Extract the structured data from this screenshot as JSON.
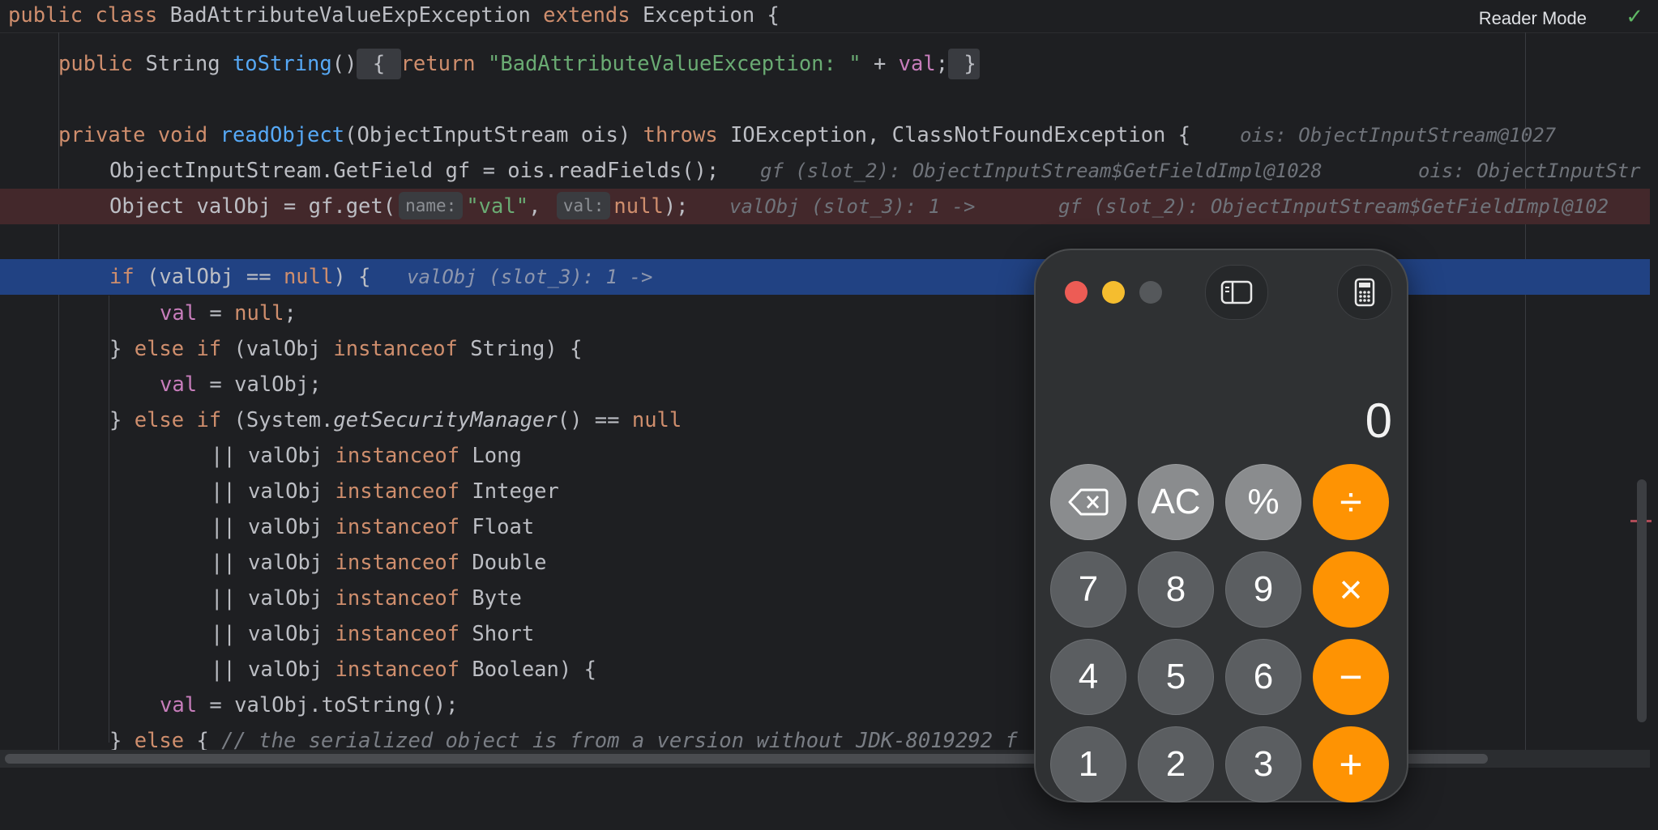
{
  "editor": {
    "header": {
      "class_kw": "public class ",
      "class_name": "BadAttributeValueExpException ",
      "extends_kw": "extends ",
      "super_name": "Exception {",
      "reader_mode": "Reader Mode",
      "check_icon": "check-icon"
    },
    "lines": {
      "l1": {
        "a": "public ",
        "b": "String ",
        "c": "toString",
        "d": "()",
        "e": " { ",
        "f": "return ",
        "g": "\"BadAttributeValueException: \"",
        "h": " + ",
        "i": "val",
        "j": ";",
        "k": " }"
      },
      "l2": {
        "a": "private void ",
        "b": "readObject",
        "c": "(ObjectInputStream ois) ",
        "d": "throws ",
        "e": "IOException, ClassNotFoundException {",
        "hint": "ois: ObjectInputStream@1027"
      },
      "l3": {
        "code": "ObjectInputStream.GetField gf = ois.readFields();",
        "hint1": "gf (slot_2): ObjectInputStream$GetFieldImpl@1028",
        "hint2": "ois: ObjectInputStr"
      },
      "l4": {
        "a": "Object valObj = gf.get(",
        "tag1": "name:",
        "b": "\"val\"",
        "c": ", ",
        "tag2": "val:",
        "d": "null",
        "e": ");",
        "hint1": "valObj (slot_3): 1 ->",
        "hint2": "gf (slot_2): ObjectInputStream$GetFieldImpl@102"
      },
      "l5": {
        "a": "if ",
        "b": "(valObj == ",
        "c": "null",
        "d": ") {",
        "hint": "valObj (slot_3): 1 ->"
      },
      "l6": {
        "a": "val",
        "b": " = ",
        "c": "null",
        "d": ";"
      },
      "l7": {
        "a": "} ",
        "b": "else if ",
        "c": "(valObj ",
        "d": "instanceof ",
        "e": "String) {"
      },
      "l8": {
        "a": "val",
        "b": " = valObj;"
      },
      "l9": {
        "a": "} ",
        "b": "else if ",
        "c": "(System.",
        "d": "getSecurityManager",
        "e": "() == ",
        "f": "null"
      },
      "l10": {
        "a": "|| valObj ",
        "b": "instanceof ",
        "c": "Long"
      },
      "l11": {
        "a": "|| valObj ",
        "b": "instanceof ",
        "c": "Integer"
      },
      "l12": {
        "a": "|| valObj ",
        "b": "instanceof ",
        "c": "Float"
      },
      "l13": {
        "a": "|| valObj ",
        "b": "instanceof ",
        "c": "Double"
      },
      "l14": {
        "a": "|| valObj ",
        "b": "instanceof ",
        "c": "Byte"
      },
      "l15": {
        "a": "|| valObj ",
        "b": "instanceof ",
        "c": "Short"
      },
      "l16": {
        "a": "|| valObj ",
        "b": "instanceof ",
        "c": "Boolean) {"
      },
      "l17": {
        "a": "val",
        "b": " = valObj.toString();"
      },
      "l18": {
        "a": "} ",
        "b": "else ",
        "c": "{ ",
        "d": "// the serialized object is from a version without JDK-8019292 f"
      }
    }
  },
  "calculator": {
    "display": "0",
    "sidebar_icon": "sidebar-icon",
    "calc_icon": "calculator-icon",
    "keys": {
      "backspace": "⌫",
      "ac": "AC",
      "percent": "%",
      "divide": "÷",
      "k7": "7",
      "k8": "8",
      "k9": "9",
      "multiply": "×",
      "k4": "4",
      "k5": "5",
      "k6": "6",
      "minus": "−",
      "k1": "1",
      "k2": "2",
      "k3": "3",
      "plus": "+"
    },
    "colors": {
      "operator": "#fe9303",
      "number": "#5b5e61",
      "function": "#8a8c8e"
    }
  }
}
